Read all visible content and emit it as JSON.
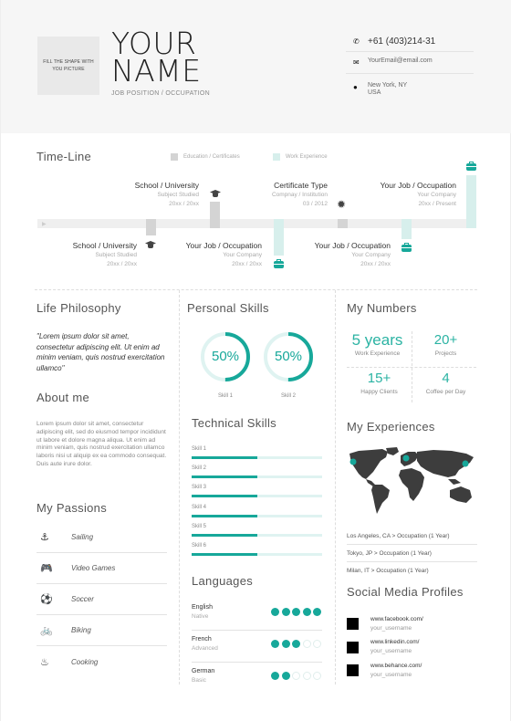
{
  "header": {
    "photo_placeholder": "FILL THE SHAPE WITH YOU PICTURE",
    "name_line1": "YOUR",
    "name_line2": "NAME",
    "job_position": "JOB POSITION / OCCUPATION",
    "contact": {
      "phone": "+61 (403)214-31",
      "email": "YourEmail@email.com",
      "address_line1": "New York, NY",
      "address_line2": "USA"
    }
  },
  "timeline": {
    "title": "Time-Line",
    "legend": [
      {
        "label": "Education / Certificates",
        "color": "#d4d4d4"
      },
      {
        "label": "Work Experience",
        "color": "#d7efec"
      }
    ],
    "entries": [
      {
        "title": "School / University",
        "line2": "Subject Studied",
        "line3": "20xx / 20xx",
        "type": "education",
        "side": "below",
        "icon": "graduation-cap-icon"
      },
      {
        "title": "School / University",
        "line2": "Subject Studied",
        "line3": "20xx / 20xx",
        "type": "education",
        "side": "above",
        "icon": "graduation-cap-icon"
      },
      {
        "title": "Your Job / Occupation",
        "line2": "Your Company",
        "line3": "20xx / 20xx",
        "type": "work",
        "side": "below",
        "icon": "briefcase-icon"
      },
      {
        "title": "Certificate Type",
        "line2": "Compnay / Institution",
        "line3": "03 / 2012",
        "type": "education",
        "side": "above",
        "icon": "award-ribbon-icon"
      },
      {
        "title": "Your Job / Occupation",
        "line2": "Your Company",
        "line3": "20xx / 20xx",
        "type": "work",
        "side": "below",
        "icon": "briefcase-icon"
      },
      {
        "title": "Your Job / Occupation",
        "line2": "Your Company",
        "line3": "20xx / Present",
        "type": "work",
        "side": "above",
        "icon": "briefcase-icon"
      }
    ]
  },
  "life_philosophy": {
    "title": "Life Philosophy",
    "quote": "\"Lorem ipsum dolor sit amet, consectetur adipiscing elit. Ut enim ad minim veniam, quis nostrud exercitation ullamco\""
  },
  "about_me": {
    "title": "About me",
    "text": "Lorem ipsum dolor sit amet, consectetur adipiscing elit, sed do eiusmod tempor incididunt ut labore et dolore magna aliqua. Ut enim ad minim veniam, quis nostrud exercitation ullamco laboris nisi ut aliquip ex ea commodo consequat. Duis aute irure dolor."
  },
  "passions": {
    "title": "My Passions",
    "items": [
      {
        "label": "Sailing",
        "icon": "anchor-icon",
        "glyph": "⚓"
      },
      {
        "label": "Video Games",
        "icon": "gamepad-icon",
        "glyph": "🎮"
      },
      {
        "label": "Soccer",
        "icon": "soccer-ball-icon",
        "glyph": "⚽"
      },
      {
        "label": "Biking",
        "icon": "bicycle-icon",
        "glyph": "🚲"
      },
      {
        "label": "Cooking",
        "icon": "chef-hat-icon",
        "glyph": "♨"
      }
    ]
  },
  "personal_skills": {
    "title": "Personal Skills",
    "items": [
      {
        "label": "Skill 1",
        "percent": 50,
        "display": "50%"
      },
      {
        "label": "Skill 2",
        "percent": 50,
        "display": "50%"
      }
    ]
  },
  "technical_skills": {
    "title": "Technical Skills",
    "items": [
      {
        "label": "Skill 1",
        "level": 0.5
      },
      {
        "label": "Skill 2",
        "level": 0.5
      },
      {
        "label": "Skill 3",
        "level": 0.5
      },
      {
        "label": "Skill 4",
        "level": 0.5
      },
      {
        "label": "Skill 5",
        "level": 0.5
      },
      {
        "label": "Skill 6",
        "level": 0.5
      }
    ]
  },
  "languages": {
    "title": "Languages",
    "items": [
      {
        "name": "English",
        "level": "Native",
        "dots": 5,
        "max": 5
      },
      {
        "name": "French",
        "level": "Advanced",
        "dots": 3,
        "max": 5
      },
      {
        "name": "German",
        "level": "Basic",
        "dots": 2,
        "max": 5
      }
    ]
  },
  "numbers": {
    "title": "My Numbers",
    "items": [
      {
        "value": "5 years",
        "label": "Work Experience"
      },
      {
        "value": "20+",
        "label": "Projects"
      },
      {
        "value": "15+",
        "label": "Happy Clients"
      },
      {
        "value": "4",
        "label": "Coffee per Day"
      }
    ]
  },
  "experiences": {
    "title": "My Experiences",
    "items": [
      "Los Angeles, CA > Occupation (1 Year)",
      "Tokyo, JP > Occupation (1 Year)",
      "Milan, IT > Occupation (1 Year)"
    ]
  },
  "social": {
    "title": "Social Media Profiles",
    "items": [
      {
        "url": "www.facebook.com/",
        "handle": "your_username"
      },
      {
        "url": "www.linkedin.com/",
        "handle": "your_username"
      },
      {
        "url": "www.behance.com/",
        "handle": "your_username"
      }
    ]
  },
  "colors": {
    "accent": "#17a89a",
    "accent_light": "#d7efec",
    "education": "#d4d4d4",
    "header_bg": "#f6f6f6",
    "map": "#3d3d3d"
  }
}
